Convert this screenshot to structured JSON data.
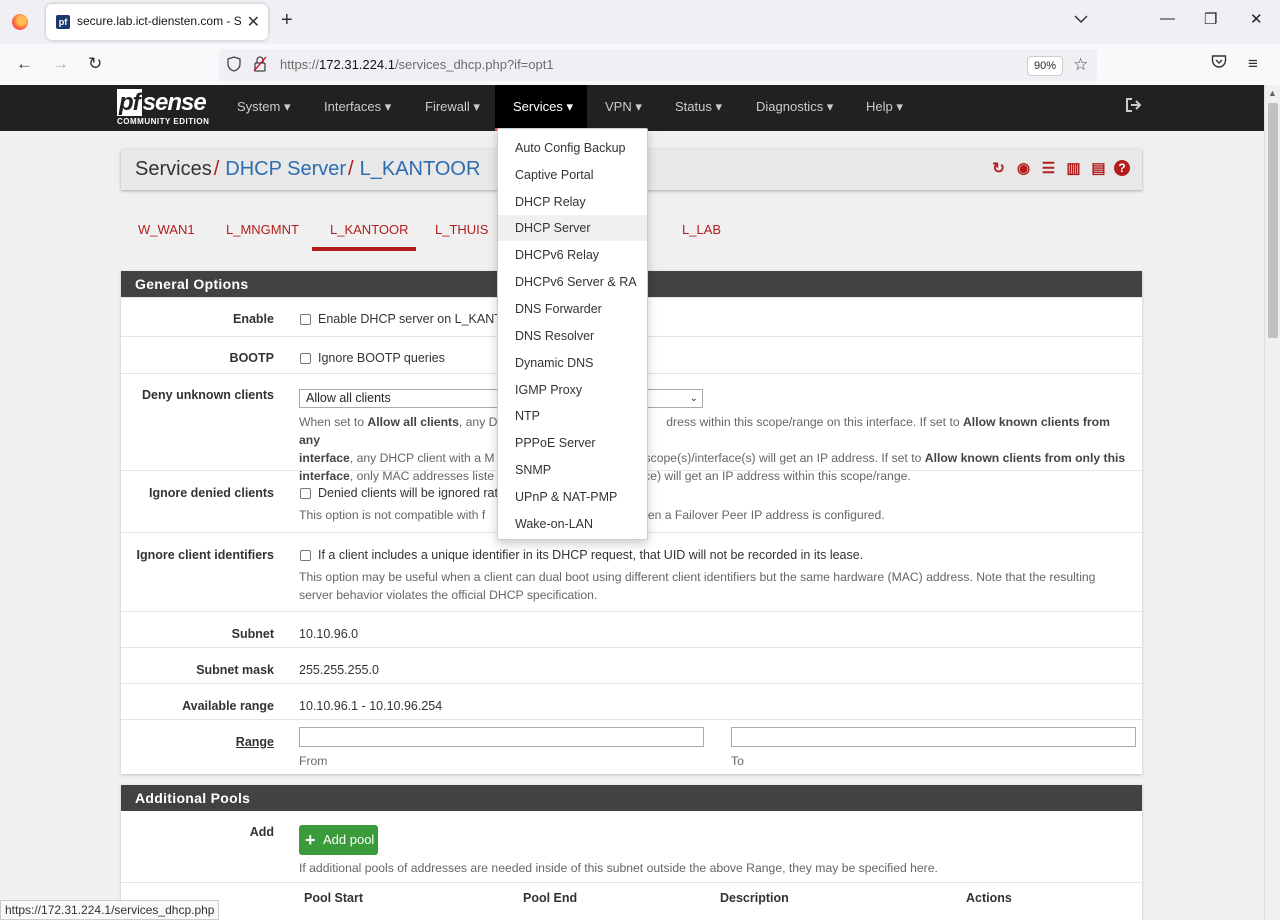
{
  "browser": {
    "tab_title": "secure.lab.ict-diensten.com - Se",
    "url_prefix": "https://",
    "url_host": "172.31.224.1",
    "url_path": "/services_dhcp.php?if=opt1",
    "zoom": "90%",
    "status_url": "https://172.31.224.1/services_dhcp.php"
  },
  "logo": {
    "pf": "pf",
    "sense": "sense",
    "edition": "COMMUNITY EDITION"
  },
  "menu": {
    "system": "System ▾",
    "interfaces": "Interfaces ▾",
    "firewall": "Firewall ▾",
    "services": "Services ▾",
    "vpn": "VPN ▾",
    "status": "Status ▾",
    "diagnostics": "Diagnostics ▾",
    "help": "Help ▾"
  },
  "breadcrumb": {
    "root": "Services",
    "section": "DHCP Server",
    "page": "L_KANTOOR"
  },
  "tabs": [
    "W_WAN1",
    "L_MNGMNT",
    "L_KANTOOR",
    "L_THUIS",
    "L_LAB"
  ],
  "services_menu": [
    "Auto Config Backup",
    "Captive Portal",
    "DHCP Relay",
    "DHCP Server",
    "DHCPv6 Relay",
    "DHCPv6 Server & RA",
    "DNS Forwarder",
    "DNS Resolver",
    "Dynamic DNS",
    "IGMP Proxy",
    "NTP",
    "PPPoE Server",
    "SNMP",
    "UPnP & NAT-PMP",
    "Wake-on-LAN"
  ],
  "general": {
    "title": "General Options",
    "enable_label": "Enable",
    "enable_text": "Enable DHCP server on L_KANTO",
    "bootp_label": "BOOTP",
    "bootp_text": "Ignore BOOTP queries",
    "deny_label": "Deny unknown clients",
    "deny_value": "Allow all clients",
    "deny_help_1a": "When set to ",
    "deny_help_1b": "Allow all clients",
    "deny_help_1c": ", any DH",
    "deny_help_1d": "dress within this scope/range on this interface. If set to ",
    "deny_help_1e": "Allow known clients from any",
    "deny_help_2a": "interface",
    "deny_help_2b": ", any DHCP client with a M",
    "deny_help_2c": "scope(s)/interface(s) will get an IP address. If set to ",
    "deny_help_2d": "Allow known clients from only this",
    "deny_help_3a": "interface",
    "deny_help_3b": ", only MAC addresses liste",
    "deny_help_3c": "ce) will get an IP address within this scope/range.",
    "ignore_denied_label": "Ignore denied clients",
    "ignore_denied_text": "Denied clients will be ignored rat",
    "ignore_denied_help_a": "This option is not compatible with f",
    "ignore_denied_help_b": "ed when a Failover Peer IP address is configured.",
    "ignore_uid_label": "Ignore client identifiers",
    "ignore_uid_text": "If a client includes a unique identifier in its DHCP request, that UID will not be recorded in its lease.",
    "ignore_uid_help": "This option may be useful when a client can dual boot using different client identifiers but the same hardware (MAC) address. Note that the resulting server behavior violates the official DHCP specification.",
    "subnet_label": "Subnet",
    "subnet_value": "10.10.96.0",
    "mask_label": "Subnet mask",
    "mask_value": "255.255.255.0",
    "range_avail_label": "Available range",
    "range_avail_value": "10.10.96.1 - 10.10.96.254",
    "range_label": "Range",
    "range_from_value": "",
    "range_to_value": "",
    "from_hint": "From",
    "to_hint": "To"
  },
  "pools": {
    "title": "Additional Pools",
    "add_label": "Add",
    "add_button": "Add pool",
    "help": "If additional pools of addresses are needed inside of this subnet outside the above Range, they may be specified here.",
    "columns": [
      "Pool Start",
      "Pool End",
      "Description",
      "Actions"
    ]
  },
  "colors": {
    "accent_red": "#b31d1d",
    "header_dark": "#212121",
    "add_green": "#3a9b3a",
    "link_blue": "#2c6cb0"
  }
}
